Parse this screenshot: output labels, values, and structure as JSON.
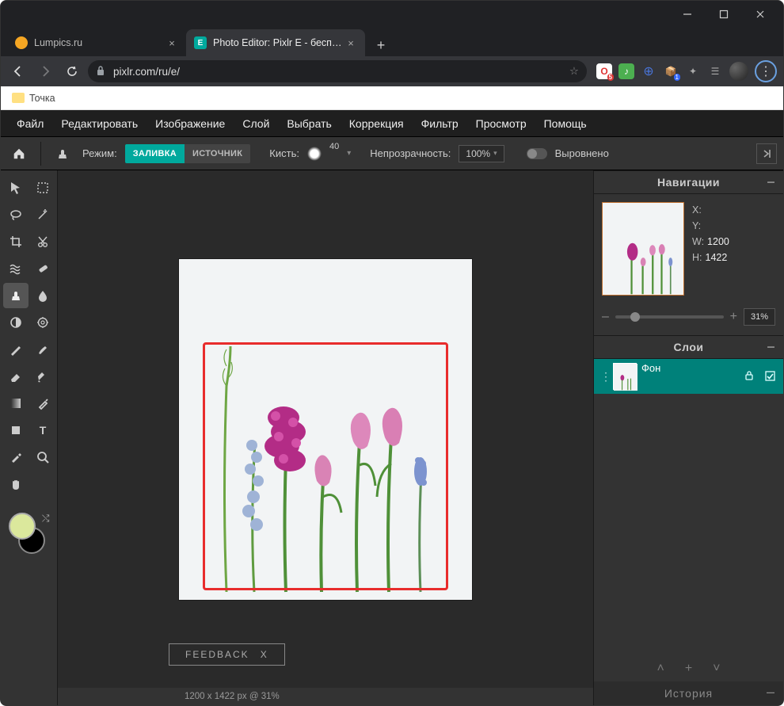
{
  "window": {
    "tabs": [
      {
        "title": "Lumpics.ru",
        "favicon_color": "#f5a623"
      },
      {
        "title": "Photo Editor: Pixlr E - бесплатны",
        "favicon_color": "#00A99D"
      }
    ],
    "url": "pixlr.com/ru/e/",
    "bookmark": "Точка"
  },
  "menubar": [
    "Файл",
    "Редактировать",
    "Изображение",
    "Слой",
    "Выбрать",
    "Коррекция",
    "Фильтр",
    "Просмотр",
    "Помощь"
  ],
  "toolbar": {
    "mode_label": "Режим:",
    "mode_fill": "ЗАЛИВКА",
    "mode_source": "ИСТОЧНИК",
    "brush_label": "Кисть:",
    "brush_size": "40",
    "opacity_label": "Непрозрачность:",
    "opacity_value": "100%",
    "aligned_label": "Выровнено"
  },
  "nav_panel": {
    "title": "Навигации",
    "x_label": "X:",
    "y_label": "Y:",
    "w_label": "W:",
    "w_value": "1200",
    "h_label": "H:",
    "h_value": "1422",
    "zoom_pct": "31%"
  },
  "layers_panel": {
    "title": "Слои",
    "layers": [
      {
        "name": "Фон"
      }
    ]
  },
  "history_panel": {
    "title": "История"
  },
  "feedback": {
    "label": "FEEDBACK",
    "close": "X"
  },
  "status": "1200 x 1422 px @ 31%",
  "colors": {
    "fg": "#dbe89c",
    "bg": "#000000"
  }
}
